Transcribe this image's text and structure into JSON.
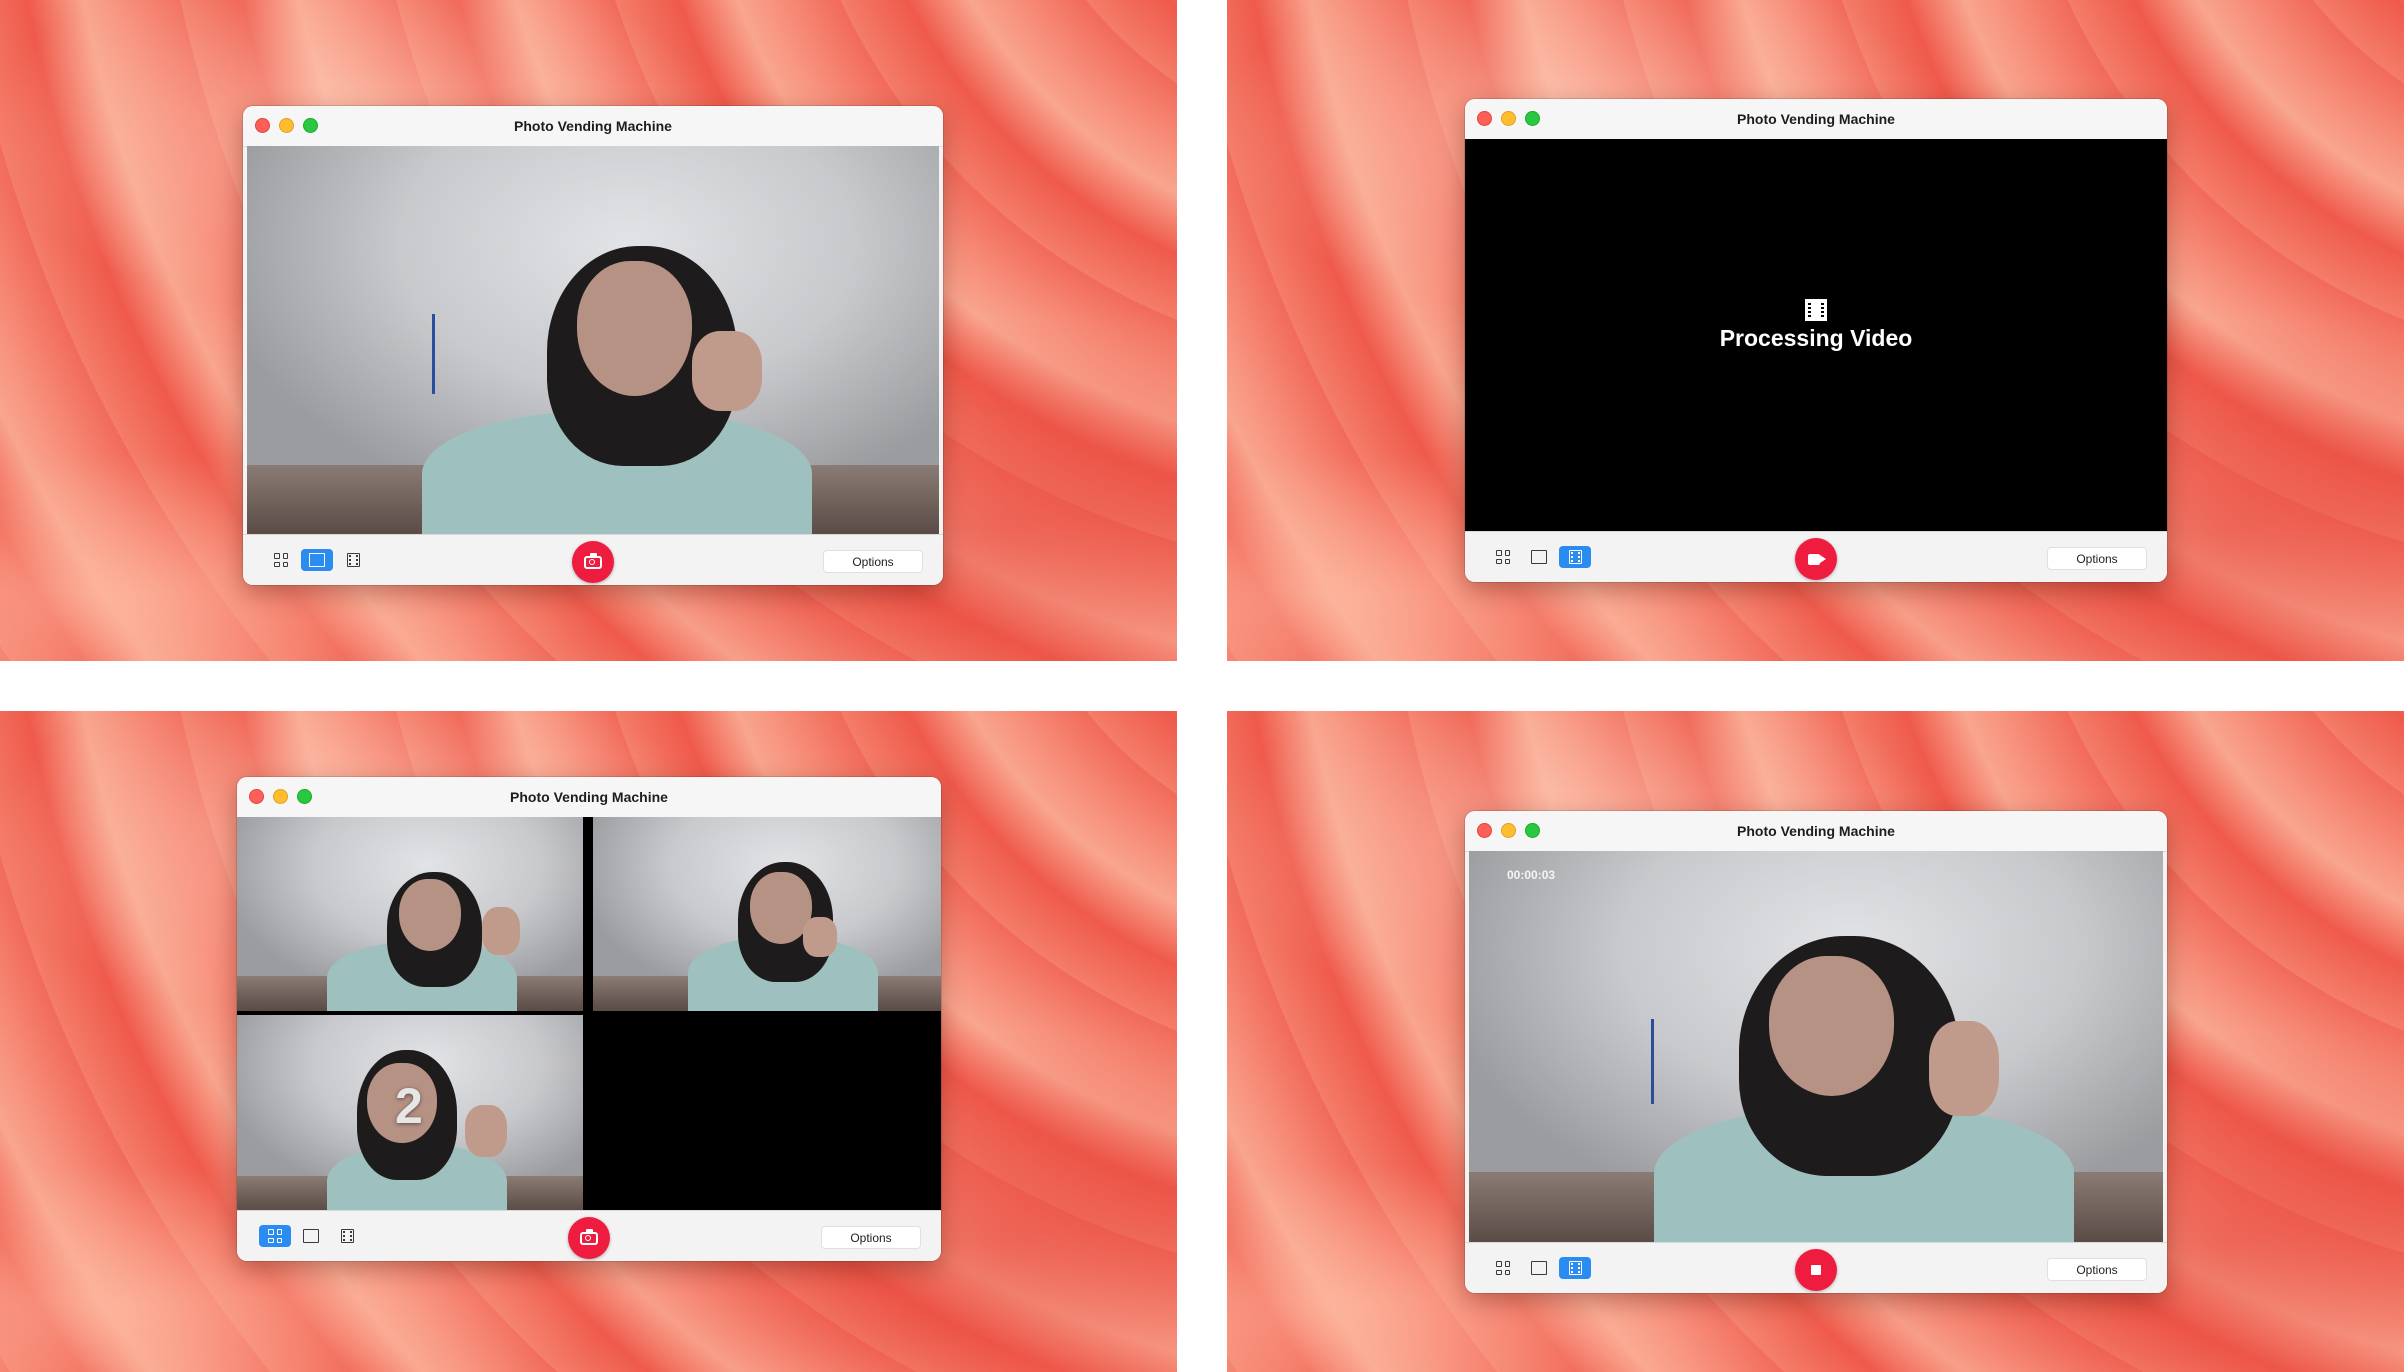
{
  "screens": [
    {
      "title": "Photo Vending Machine",
      "options_label": "Options",
      "mode": "single",
      "capture": "photo"
    },
    {
      "title": "Photo Vending Machine",
      "options_label": "Options",
      "mode": "video",
      "capture": "video",
      "status": "Processing Video"
    },
    {
      "title": "Photo Vending Machine",
      "options_label": "Options",
      "mode": "grid",
      "capture": "photo",
      "countdown": "2"
    },
    {
      "title": "Photo Vending Machine",
      "options_label": "Options",
      "mode": "video",
      "capture": "stop",
      "timer": "00:00:03"
    }
  ],
  "icons": {
    "mode_buttons": [
      "grid-icon",
      "single-frame-icon",
      "film-icon"
    ],
    "capture_photo": "camera-icon",
    "capture_video": "video-camera-icon",
    "capture_stop": "stop-icon"
  },
  "colors": {
    "capture_button": "#ee1d3f",
    "active_mode": "#2a8cf0",
    "traffic_close": "#fe5f57",
    "traffic_min": "#febc2e",
    "traffic_max": "#28c840"
  }
}
